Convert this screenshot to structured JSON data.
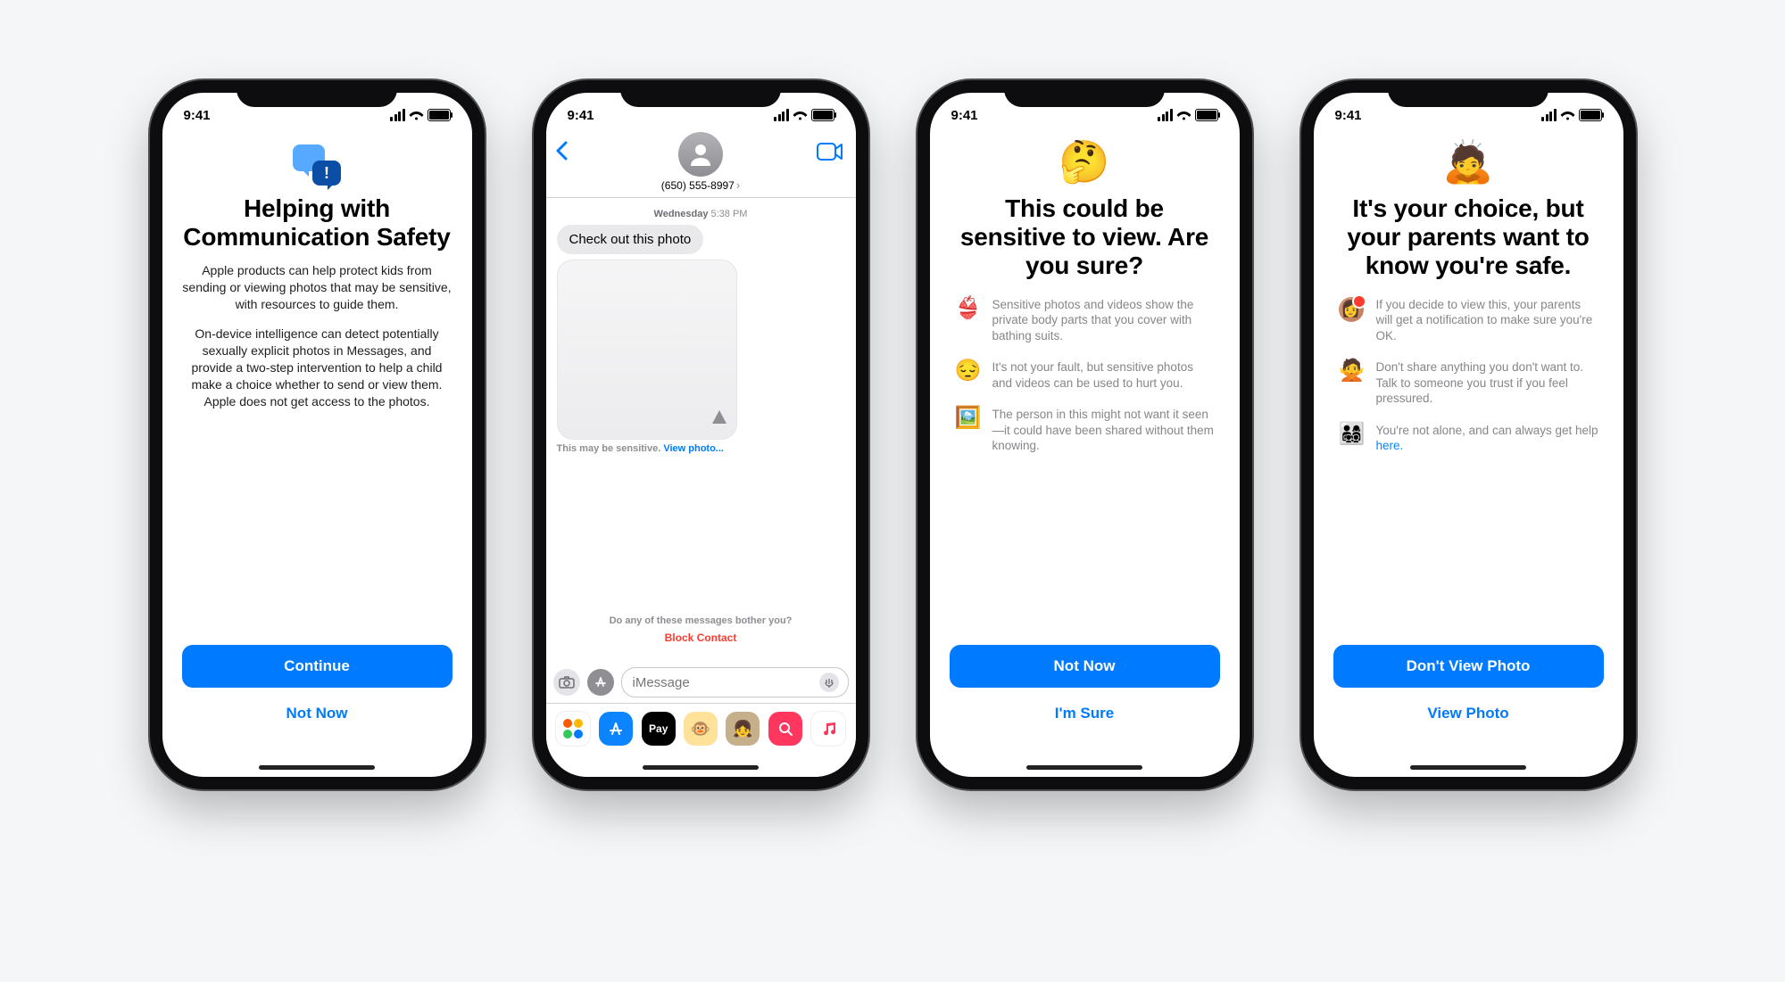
{
  "status": {
    "time": "9:41"
  },
  "phone1": {
    "title": "Helping with Communication Safety",
    "p1": "Apple products can help protect kids from sending or viewing photos that may be sensitive, with resources to guide them.",
    "p2": "On-device intelligence can detect potentially sexually explicit photos in Messages, and provide a two-step intervention to help a child make a choice whether to send or view them. Apple does not get access to the photos.",
    "primary": "Continue",
    "secondary": "Not Now"
  },
  "phone2": {
    "contact": "(650) 555-8997",
    "ts_day": "Wednesday",
    "ts_time": " 5:38 PM",
    "bubble1": "Check out this photo",
    "sensitive_label": "This may be sensitive. ",
    "view_photo": "View photo...",
    "bother": "Do any of these messages bother you?",
    "block": "Block Contact",
    "placeholder": "iMessage",
    "applepay": "Pay"
  },
  "phone3": {
    "emoji": "🤔",
    "title": "This could be sensitive to view. Are you sure?",
    "rows": [
      {
        "emoji": "👙",
        "text": "Sensitive photos and videos show the private body parts that you cover with bathing suits."
      },
      {
        "emoji": "😔",
        "text": "It's not your fault, but sensitive photos and videos can be used to hurt you."
      },
      {
        "emoji": "🖼️",
        "text": "The person in this might not want it seen—it could have been shared without them knowing."
      }
    ],
    "primary": "Not Now",
    "secondary": "I'm Sure"
  },
  "phone4": {
    "emoji": "🙇",
    "title": "It's your choice, but your parents want to know you're safe.",
    "rows": [
      {
        "type": "avatar",
        "text": "If you decide to view this, your parents will get a notification to make sure you're OK."
      },
      {
        "emoji": "🙅",
        "text": "Don't share anything you don't want to. Talk to someone you trust if you feel pressured."
      },
      {
        "emoji": "👨‍👩‍👧‍👦",
        "text": "You're not alone, and can always get help ",
        "link": "here."
      }
    ],
    "primary": "Don't View Photo",
    "secondary": "View Photo"
  }
}
